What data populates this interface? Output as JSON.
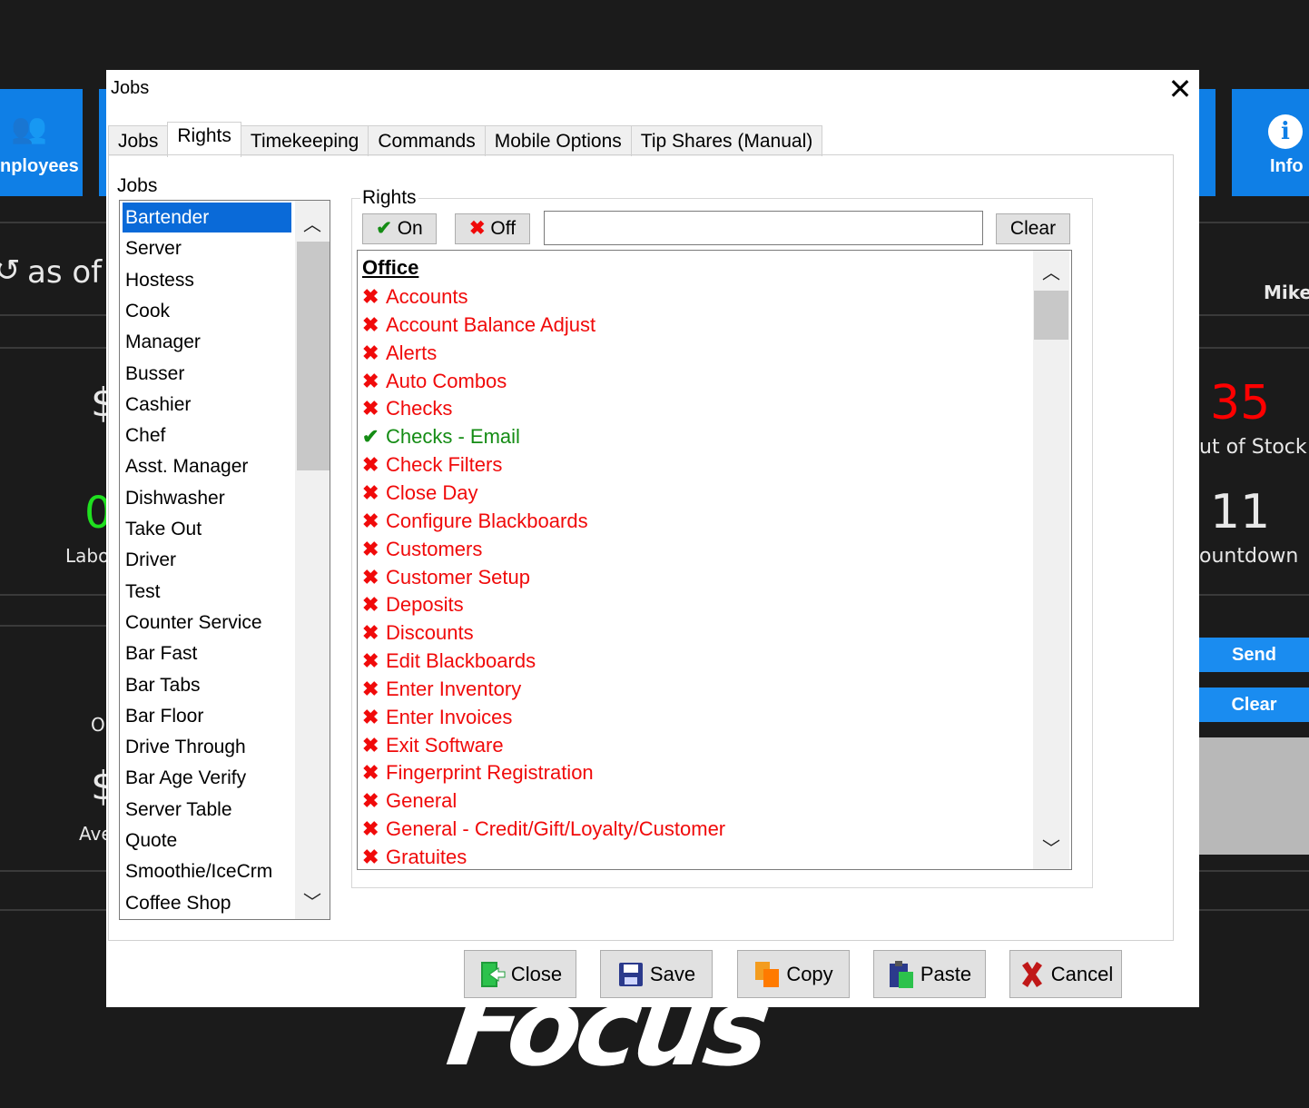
{
  "background": {
    "employees_label": "nployees",
    "info_label": "Info",
    "as_of_text": "as of",
    "user_name": "Mike",
    "out_of_stock_count": "35",
    "out_of_stock_label": "ut of Stock",
    "countdown_count": "11",
    "countdown_label": "ountdown",
    "labor_count": "0",
    "labor_label": "Labo",
    "left_dollar_1": "$",
    "left_dollar_2": "$",
    "left_o": "O",
    "left_ave": "Ave",
    "send_button": "Send",
    "clear_button": "Clear",
    "logo_text": "Focus"
  },
  "dialog": {
    "title": "Jobs",
    "close_glyph": "✕",
    "tabs": [
      {
        "label": "Jobs",
        "active": false
      },
      {
        "label": "Rights",
        "active": true
      },
      {
        "label": "Timekeeping",
        "active": false
      },
      {
        "label": "Commands",
        "active": false
      },
      {
        "label": "Mobile Options",
        "active": false
      },
      {
        "label": "Tip Shares (Manual)",
        "active": false
      }
    ],
    "jobs_label": "Jobs",
    "jobs": [
      "Bartender",
      "Server",
      "Hostess",
      "Cook",
      "Manager",
      "Busser",
      "Cashier",
      "Chef",
      "Asst. Manager",
      "Dishwasher",
      "Take Out",
      "Driver",
      "Test",
      "Counter Service",
      "Bar Fast",
      "Bar Tabs",
      "Bar Floor",
      "Drive Through",
      "Bar Age Verify",
      "Server Table",
      "Quote",
      "Smoothie/IceCrm",
      "Coffee Shop"
    ],
    "selected_job": "Bartender",
    "rights_group_label": "Rights",
    "on_button": "On",
    "off_button": "Off",
    "filter_value": "",
    "clear_button": "Clear",
    "section_title": "Office",
    "rights": [
      {
        "label": "Accounts",
        "on": false
      },
      {
        "label": "Account Balance Adjust",
        "on": false
      },
      {
        "label": "Alerts",
        "on": false
      },
      {
        "label": "Auto Combos",
        "on": false
      },
      {
        "label": "Checks",
        "on": false
      },
      {
        "label": "Checks - Email",
        "on": true
      },
      {
        "label": "Check Filters",
        "on": false
      },
      {
        "label": "Close Day",
        "on": false
      },
      {
        "label": "Configure Blackboards",
        "on": false
      },
      {
        "label": "Customers",
        "on": false
      },
      {
        "label": "Customer Setup",
        "on": false
      },
      {
        "label": "Deposits",
        "on": false
      },
      {
        "label": "Discounts",
        "on": false
      },
      {
        "label": "Edit Blackboards",
        "on": false
      },
      {
        "label": "Enter Inventory",
        "on": false
      },
      {
        "label": "Enter Invoices",
        "on": false
      },
      {
        "label": "Exit Software",
        "on": false
      },
      {
        "label": "Fingerprint Registration",
        "on": false
      },
      {
        "label": "General",
        "on": false
      },
      {
        "label": "General - Credit/Gift/Loyalty/Customer",
        "on": false
      },
      {
        "label": "Gratuites",
        "on": false
      }
    ],
    "footer": {
      "close_label": "Close",
      "save_label": "Save",
      "copy_label": "Copy",
      "paste_label": "Paste",
      "cancel_label": "Cancel"
    }
  },
  "colors": {
    "accent_blue": "#0f7fe6",
    "selection": "#0a6ad8",
    "off_red": "#f00a0a",
    "on_green": "#148c14",
    "out_of_stock_red": "#ff0000",
    "labor_green": "#1fe01f"
  }
}
